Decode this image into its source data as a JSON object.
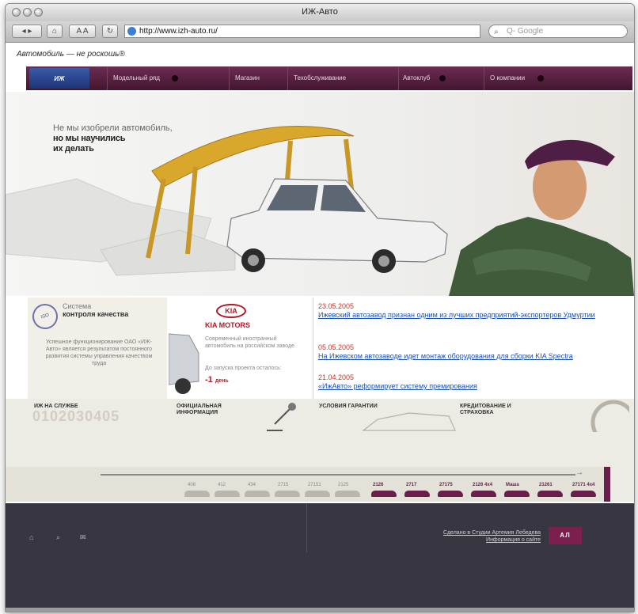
{
  "browser": {
    "window_title": "ИЖ-Авто",
    "url": "http://www.izh-auto.ru/",
    "search_placeholder": "Q- Google",
    "text_size_label": "A A"
  },
  "site": {
    "slogan": "Автомобиль — не роскошь®",
    "nav": [
      "Модельный ряд",
      "Магазин",
      "Техобслуживание",
      "Автоклуб",
      "О компании"
    ]
  },
  "hero": {
    "line1": "Не мы изобрели автомобиль,",
    "line2": "но мы научились",
    "line3": "их делать"
  },
  "quality": {
    "title_top": "Система",
    "title_bold": "контроля качества",
    "text": "Успешное функционирование ОАО «ИЖ-Авто» является результатом постоянного развития системы управления качеством труда"
  },
  "kia": {
    "logo": "KIA",
    "brand": "KIA MOTORS",
    "text": "Современный иностранный автомобиль на российском заводе.",
    "countdown_label": "До запуска проекта осталось:",
    "days_value": "-1",
    "days_unit": "день"
  },
  "news": [
    {
      "date": "23.05.2005",
      "title": "Ижевский автозавод признан одним из лучших предприятий-экспортеров Удмуртии"
    },
    {
      "date": "05.05.2005",
      "title": "На Ижевском автозаводе идет монтаж оборудования для сборки KIA Spectra"
    },
    {
      "date": "21.04.2005",
      "title": "«ИжАвто» реформирует систему премирования"
    }
  ],
  "sections": {
    "izh_service": "ИЖ на службе",
    "service_numbers": "0102030405",
    "official_info": "Официальная информация",
    "warranty": "Условия гарантии",
    "credit": "Кредитование и страховка"
  },
  "timeline": {
    "models_old": [
      "408",
      "412",
      "434",
      "2715",
      "27151",
      "2125"
    ],
    "models_new": [
      "2126",
      "2717",
      "27175",
      "2126 4x4",
      "Маша",
      "21261",
      "27171 4x4"
    ]
  },
  "footer": {
    "credit_text": "Сделано в Студии Артемия Лебедева",
    "site_info": "Информация о сайте",
    "badge": "АЛ"
  },
  "colors": {
    "brand_purple": "#5a2043",
    "link_blue": "#1a4fb4",
    "date_red": "#c0392b",
    "kia_red": "#b31726"
  }
}
